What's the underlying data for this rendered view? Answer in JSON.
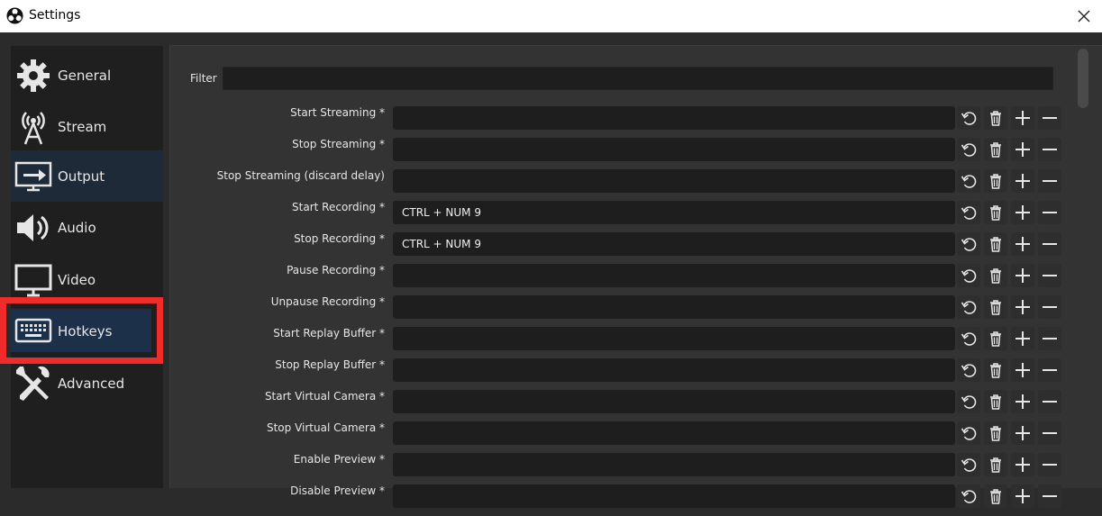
{
  "window": {
    "title": "Settings"
  },
  "sidebar": {
    "items": [
      {
        "label": "General",
        "icon": "gear-icon"
      },
      {
        "label": "Stream",
        "icon": "antenna-icon"
      },
      {
        "label": "Output",
        "icon": "output-icon"
      },
      {
        "label": "Audio",
        "icon": "speaker-icon"
      },
      {
        "label": "Video",
        "icon": "monitor-icon"
      },
      {
        "label": "Hotkeys",
        "icon": "keyboard-icon",
        "selected": true
      },
      {
        "label": "Advanced",
        "icon": "tools-icon"
      }
    ]
  },
  "filter": {
    "label": "Filter",
    "value": ""
  },
  "hotkeys": [
    {
      "label": "Start Streaming *",
      "value": ""
    },
    {
      "label": "Stop Streaming *",
      "value": ""
    },
    {
      "label": "Stop Streaming (discard delay)",
      "value": ""
    },
    {
      "label": "Start Recording *",
      "value": "CTRL + NUM 9"
    },
    {
      "label": "Stop Recording *",
      "value": "CTRL + NUM 9"
    },
    {
      "label": "Pause Recording *",
      "value": ""
    },
    {
      "label": "Unpause Recording *",
      "value": ""
    },
    {
      "label": "Start Replay Buffer *",
      "value": ""
    },
    {
      "label": "Stop Replay Buffer *",
      "value": ""
    },
    {
      "label": "Start Virtual Camera *",
      "value": ""
    },
    {
      "label": "Stop Virtual Camera *",
      "value": ""
    },
    {
      "label": "Enable Preview *",
      "value": ""
    },
    {
      "label": "Disable Preview *",
      "value": ""
    }
  ],
  "colors": {
    "highlight": "#ef2b2b",
    "selected": "#1c3149",
    "background": "#2b2b2b"
  }
}
